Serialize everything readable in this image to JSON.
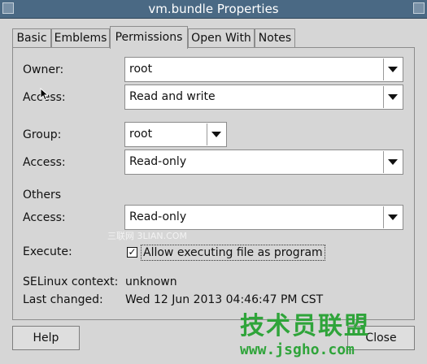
{
  "window": {
    "title": "vm.bundle Properties"
  },
  "tabs": [
    {
      "label": "Basic"
    },
    {
      "label": "Emblems"
    },
    {
      "label": "Permissions"
    },
    {
      "label": "Open With"
    },
    {
      "label": "Notes"
    }
  ],
  "permissions": {
    "owner_label": "Owner:",
    "owner_value": "root",
    "owner_access_label": "Access:",
    "owner_access_value": "Read and write",
    "group_label": "Group:",
    "group_value": "root",
    "group_access_label": "Access:",
    "group_access_value": "Read-only",
    "others_label": "Others",
    "others_access_label": "Access:",
    "others_access_value": "Read-only",
    "execute_label": "Execute:",
    "execute_checkbox_label": "Allow executing file as program",
    "execute_checked": true,
    "selinux_label": "SELinux context:",
    "selinux_value": "unknown",
    "last_changed_label": "Last changed:",
    "last_changed_value": "Wed 12 Jun 2013 04:46:47 PM CST"
  },
  "buttons": {
    "help": "Help",
    "close": "Close"
  },
  "watermarks": {
    "inline": "三联网 3LIAN.COM",
    "corner_title": "技术员联盟",
    "corner_url": "www.jsgho.com"
  }
}
